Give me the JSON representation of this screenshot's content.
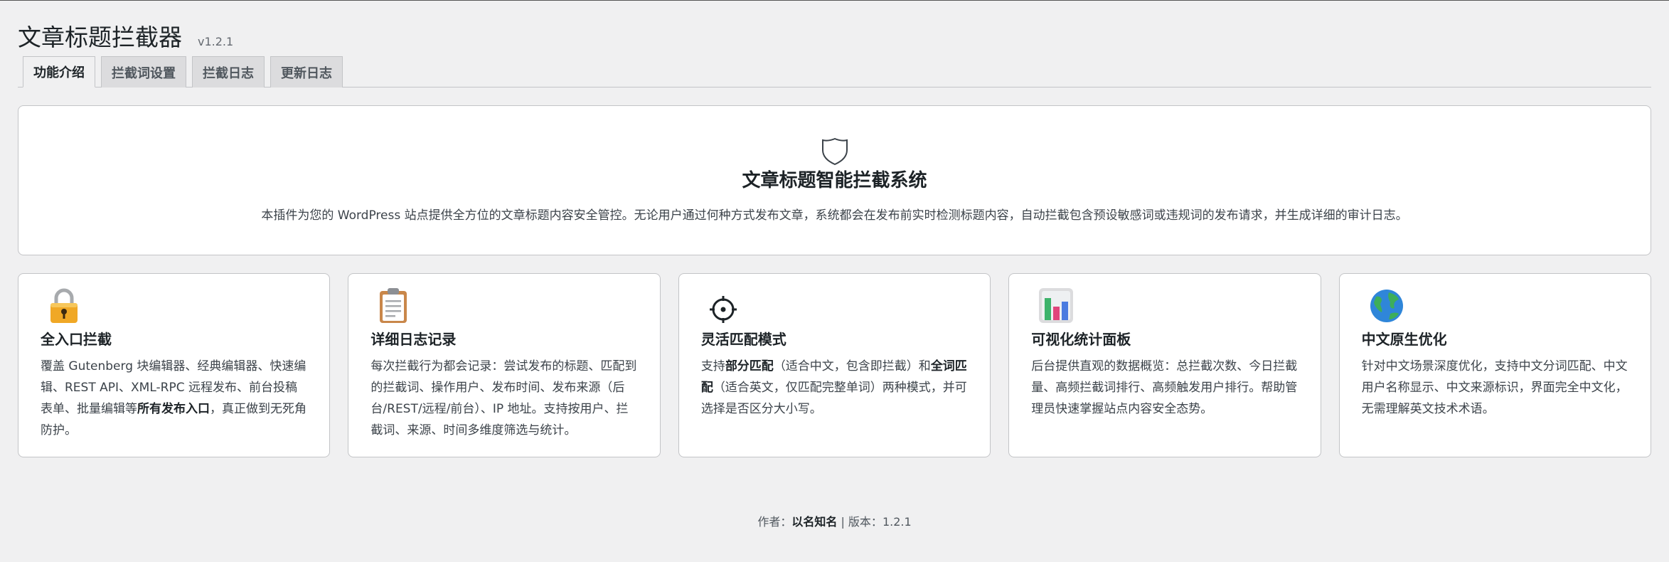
{
  "header": {
    "title": "文章标题拦截器",
    "version": "v1.2.1"
  },
  "tabs": [
    {
      "label": "功能介绍",
      "active": true
    },
    {
      "label": "拦截词设置",
      "active": false
    },
    {
      "label": "拦截日志",
      "active": false
    },
    {
      "label": "更新日志",
      "active": false
    }
  ],
  "hero": {
    "icon": "shield-icon",
    "title": "文章标题智能拦截系统",
    "description": "本插件为您的 WordPress 站点提供全方位的文章标题内容安全管控。无论用户通过何种方式发布文章，系统都会在发布前实时检测标题内容，自动拦截包含预设敏感词或违规词的发布请求，并生成详细的审计日志。"
  },
  "cards": [
    {
      "icon": "lock-icon",
      "title": "全入口拦截",
      "desc_part1": "覆盖 Gutenberg 块编辑器、经典编辑器、快速编辑、REST API、XML-RPC 远程发布、前台投稿表单、批量编辑等",
      "desc_bold1": "所有发布入口",
      "desc_part2": "，真正做到无死角防护。"
    },
    {
      "icon": "clipboard-icon",
      "title": "详细日志记录",
      "desc_part1": "每次拦截行为都会记录：尝试发布的标题、匹配到的拦截词、操作用户、发布时间、发布来源（后台/REST/远程/前台）、IP 地址。支持按用户、拦截词、来源、时间多维度筛选与统计。"
    },
    {
      "icon": "target-icon",
      "title": "灵活匹配模式",
      "desc_part1": "支持",
      "desc_bold1": "部分匹配",
      "desc_part2": "（适合中文，包含即拦截）和",
      "desc_bold2": "全词匹配",
      "desc_part3": "（适合英文，仅匹配完整单词）两种模式，并可选择是否区分大小写。"
    },
    {
      "icon": "bar-chart-icon",
      "title": "可视化统计面板",
      "desc_part1": "后台提供直观的数据概览：总拦截次数、今日拦截量、高频拦截词排行、高频触发用户排行。帮助管理员快速掌握站点内容安全态势。"
    },
    {
      "icon": "globe-icon",
      "title": "中文原生优化",
      "desc_part1": "针对中文场景深度优化，支持中文分词匹配、中文用户名称显示、中文来源标识，界面完全中文化，无需理解英文技术术语。"
    }
  ],
  "footer": {
    "author_label": "作者：",
    "author": "以名知名",
    "separator": " | ",
    "version_label": "版本：",
    "version": "1.2.1"
  }
}
